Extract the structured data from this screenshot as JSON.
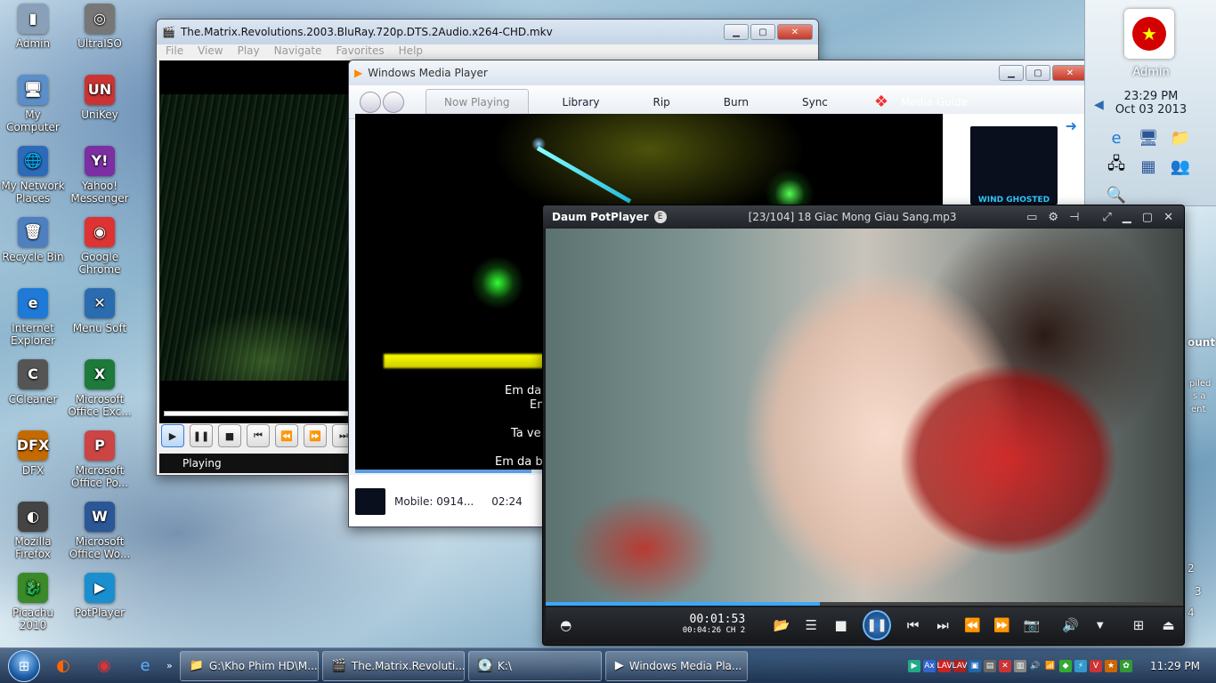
{
  "desktop": {
    "icons": [
      {
        "label": "Admin",
        "glyph": "▮",
        "color": "#8aa0b8"
      },
      {
        "label": "UltraISO",
        "glyph": "◎",
        "color": "#777"
      },
      {
        "label": "My Computer",
        "glyph": "🖥",
        "color": "#5c8fc9"
      },
      {
        "label": "UniKey",
        "glyph": "UN",
        "color": "#c33"
      },
      {
        "label": "My Network Places",
        "glyph": "🌐",
        "color": "#2d6ab8"
      },
      {
        "label": "Yahoo! Messenger",
        "glyph": "Y!",
        "color": "#7b2fa3"
      },
      {
        "label": "Recycle Bin",
        "glyph": "🗑",
        "color": "#4e7fbf"
      },
      {
        "label": "Google Chrome",
        "glyph": "◉",
        "color": "#d33"
      },
      {
        "label": "Internet Explorer",
        "glyph": "e",
        "color": "#1e7ad6"
      },
      {
        "label": "Menu Soft",
        "glyph": "✕",
        "color": "#2b6cb0"
      },
      {
        "label": "CCleaner",
        "glyph": "C",
        "color": "#555"
      },
      {
        "label": "Microsoft Office Exc...",
        "glyph": "X",
        "color": "#1d7a3a"
      },
      {
        "label": "DFX",
        "glyph": "DFX",
        "color": "#c46a00"
      },
      {
        "label": "Microsoft Office Po...",
        "glyph": "P",
        "color": "#c44"
      },
      {
        "label": "Mozilla Firefox",
        "glyph": "◐",
        "color": "#444"
      },
      {
        "label": "Microsoft Office Wo...",
        "glyph": "W",
        "color": "#2b5797"
      },
      {
        "label": "Picachu 2010",
        "glyph": "🐉",
        "color": "#3a8a2a"
      },
      {
        "label": "PotPlayer",
        "glyph": "▶",
        "color": "#1a8fd0"
      }
    ]
  },
  "mpc": {
    "title": "The.Matrix.Revolutions.2003.BluRay.720p.DTS.2Audio.x264-CHD.mkv",
    "menu": [
      "File",
      "View",
      "Play",
      "Navigate",
      "Favorites",
      "Help"
    ],
    "status": "Playing",
    "controls": [
      "▶",
      "❚❚",
      "■",
      "⏮",
      "⏪",
      "⏩",
      "⏭"
    ]
  },
  "wmp": {
    "title": "Windows Media Player",
    "tabs": {
      "now_playing": "Now Playing",
      "library": "Library",
      "rip": "Rip",
      "burn": "Burn",
      "sync": "Sync",
      "guide": "Media Guide"
    },
    "lyrics": [
      "Em da l",
      "Em",
      "Ta ve",
      "Em da bie"
    ],
    "logo_text": "WIND GHOSTED",
    "info": "Mobile: 0914...",
    "time": "02:24"
  },
  "pot": {
    "app": "Daum PotPlayer",
    "badge": "E",
    "track": "[23/104] 18 Giac Mong Giau Sang.mp3",
    "time_current": "00:01:53",
    "time_total": "00:04:26",
    "channels": "CH 2",
    "progress": 0.43
  },
  "gadget": {
    "user": "Admin",
    "time": "23:29 PM",
    "date": "Oct 03 2013"
  },
  "edge_text": {
    "ount": "ount",
    "piled": "piled",
    "as_a": "s a",
    "ent": "ent",
    "n2": "2",
    "n3": "3",
    "n4": "4"
  },
  "taskbar": {
    "buttons": [
      {
        "label": "G:\\Kho Phim HD\\M...",
        "icon": "📁"
      },
      {
        "label": "The.Matrix.Revoluti...",
        "icon": "🎬"
      },
      {
        "label": "K:\\",
        "icon": "💽"
      },
      {
        "label": "Windows Media Pla...",
        "icon": "▶"
      }
    ],
    "clock": "11:29 PM"
  }
}
